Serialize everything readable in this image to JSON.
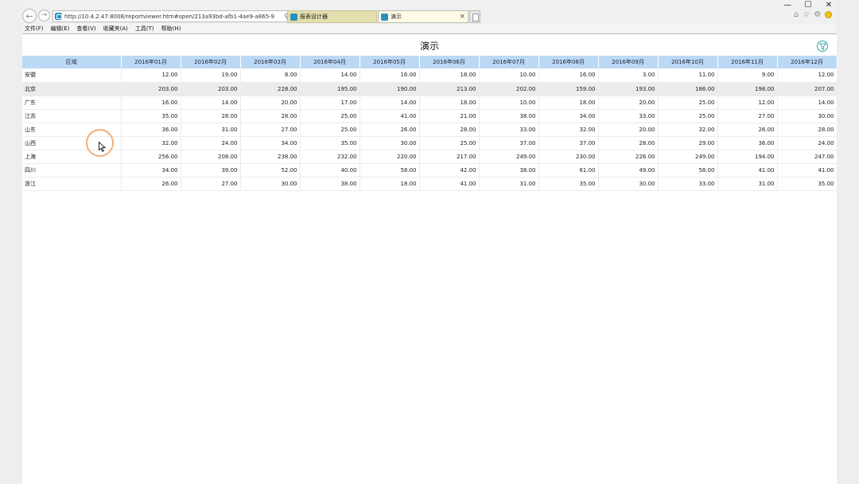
{
  "browser": {
    "url": "http://10.4.2.47:8008/reportviewer.htm#open/213a93bd-afb1-4ae9-a865-9",
    "tabs": [
      {
        "label": "报表设计器",
        "active": false
      },
      {
        "label": "演示",
        "active": true
      }
    ],
    "menu": [
      "文件(F)",
      "编辑(E)",
      "查看(V)",
      "收藏夹(A)",
      "工具(T)",
      "帮助(H)"
    ]
  },
  "report": {
    "title": "演示",
    "columns": [
      "区域",
      "2016年01月",
      "2016年02月",
      "2016年03月",
      "2016年04月",
      "2016年05月",
      "2016年06月",
      "2016年07月",
      "2016年08月",
      "2016年09月",
      "2016年10月",
      "2016年11月",
      "2016年12月"
    ],
    "rows": [
      [
        "安徽",
        "12.00",
        "19.00",
        "8.00",
        "14.00",
        "16.00",
        "18.00",
        "10.00",
        "16.00",
        "3.00",
        "11.00",
        "9.00",
        "12.00"
      ],
      [
        "北京",
        "203.00",
        "203.00",
        "228.00",
        "195.00",
        "190.00",
        "213.00",
        "202.00",
        "159.00",
        "193.00",
        "186.00",
        "198.00",
        "207.00"
      ],
      [
        "广东",
        "16.00",
        "14.00",
        "20.00",
        "17.00",
        "14.00",
        "18.00",
        "10.00",
        "18.00",
        "20.00",
        "25.00",
        "12.00",
        "14.00"
      ],
      [
        "江苏",
        "35.00",
        "28.00",
        "28.00",
        "25.00",
        "41.00",
        "21.00",
        "38.00",
        "34.00",
        "33.00",
        "25.00",
        "27.00",
        "30.00"
      ],
      [
        "山东",
        "36.00",
        "31.00",
        "27.00",
        "25.00",
        "26.00",
        "28.00",
        "33.00",
        "32.00",
        "20.00",
        "32.00",
        "26.00",
        "28.00"
      ],
      [
        "山西",
        "32.00",
        "24.00",
        "34.00",
        "35.00",
        "30.00",
        "25.00",
        "37.00",
        "37.00",
        "28.00",
        "29.00",
        "36.00",
        "24.00"
      ],
      [
        "上海",
        "256.00",
        "208.00",
        "238.00",
        "232.00",
        "220.00",
        "217.00",
        "249.00",
        "230.00",
        "226.00",
        "249.00",
        "194.00",
        "247.00"
      ],
      [
        "四川",
        "34.00",
        "39.00",
        "52.00",
        "40.00",
        "58.00",
        "42.00",
        "38.00",
        "61.00",
        "49.00",
        "58.00",
        "41.00",
        "41.00"
      ],
      [
        "浙江",
        "26.00",
        "27.00",
        "30.00",
        "38.00",
        "18.00",
        "41.00",
        "31.00",
        "35.00",
        "30.00",
        "33.00",
        "31.00",
        "35.00"
      ]
    ]
  },
  "icons": {
    "filter": "filter-icon",
    "back": "back-arrow-icon",
    "forward": "forward-arrow-icon"
  }
}
